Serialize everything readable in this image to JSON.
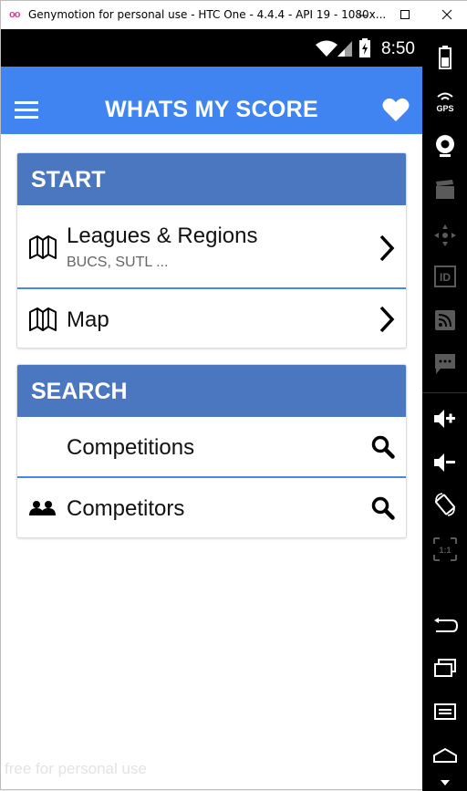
{
  "window": {
    "title": "Genymotion for personal use - HTC One - 4.4.4 - API 19 - 1080x...",
    "logo_text": "oo"
  },
  "statusbar": {
    "time": "8:50"
  },
  "appbar": {
    "title": "WHATS MY SCORE"
  },
  "start_card": {
    "header": "START",
    "rows": [
      {
        "label": "Leagues & Regions",
        "sub": "BUCS, SUTL ..."
      },
      {
        "label": "Map"
      }
    ]
  },
  "search_card": {
    "header": "SEARCH",
    "rows": [
      {
        "label": "Competitions"
      },
      {
        "label": "Competitors"
      }
    ]
  },
  "sidebar": {
    "gps_label": "GPS",
    "id_label": "ID",
    "ratio_label": "1:1"
  },
  "watermark": "free for personal use",
  "colors": {
    "accent": "#3f84f0",
    "card_header": "#4a77bf",
    "divider": "#4a86e8"
  }
}
